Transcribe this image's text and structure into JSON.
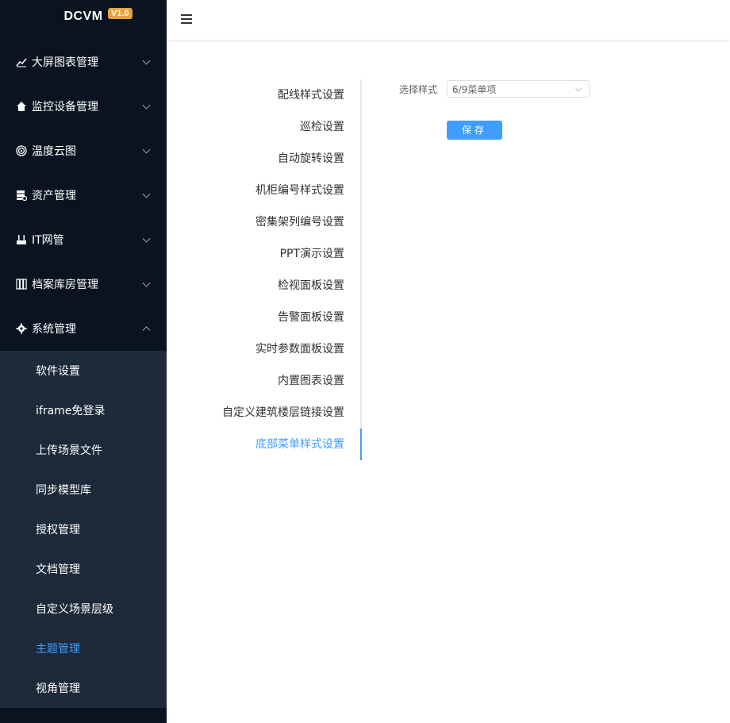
{
  "app": {
    "logo": "DCVM",
    "version": "V1.0"
  },
  "sidebar": {
    "items": [
      {
        "label": "大屏图表管理",
        "icon": "chart-line-icon"
      },
      {
        "label": "监控设备管理",
        "icon": "home-icon"
      },
      {
        "label": "温度云图",
        "icon": "target-icon"
      },
      {
        "label": "资产管理",
        "icon": "server-gear-icon"
      },
      {
        "label": "IT网管",
        "icon": "network-icon"
      },
      {
        "label": "档案库房管理",
        "icon": "archive-icon"
      },
      {
        "label": "系统管理",
        "icon": "gear-icon"
      }
    ],
    "subitems": [
      "软件设置",
      "iframe免登录",
      "上传场景文件",
      "同步模型库",
      "授权管理",
      "文档管理",
      "自定义场景层级",
      "主题管理",
      "视角管理"
    ],
    "active_subitem": "主题管理"
  },
  "tabs": [
    "配线样式设置",
    "巡检设置",
    "自动旋转设置",
    "机柜编号样式设置",
    "密集架列编号设置",
    "PPT演示设置",
    "检视面板设置",
    "告警面板设置",
    "实时参数面板设置",
    "内置图表设置",
    "自定义建筑楼层链接设置",
    "底部菜单样式设置"
  ],
  "active_tab": "底部菜单样式设置",
  "form": {
    "label": "选择样式",
    "select_value": "6/9菜单项",
    "save_label": "保存"
  },
  "colors": {
    "sidebar_bg": "#0a1421",
    "submenu_bg": "#1d2a3a",
    "accent": "#409eff",
    "badge": "#e6a23c"
  }
}
